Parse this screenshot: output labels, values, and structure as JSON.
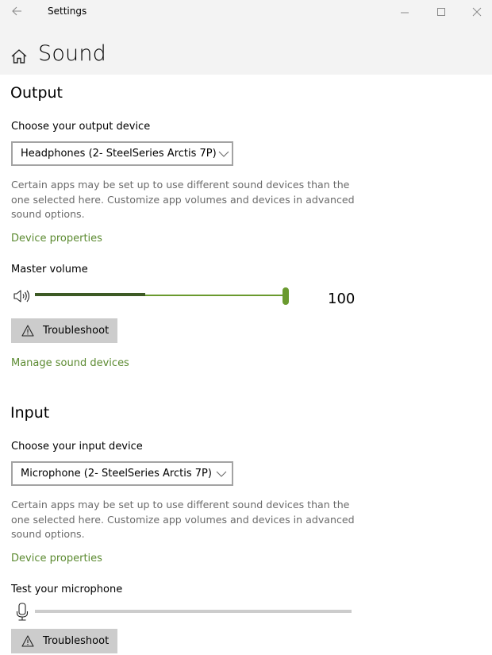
{
  "window": {
    "title": "Settings",
    "back_icon": "back-arrow-icon",
    "controls": [
      "minimize-icon",
      "maximize-icon",
      "close-icon"
    ]
  },
  "header": {
    "icon": "home-icon",
    "title": "Sound"
  },
  "output": {
    "heading": "Output",
    "device_label": "Choose your output device",
    "device_value": "Headphones (2- SteelSeries Arctis 7P)",
    "description": "Certain apps may be set up to use different sound devices than the one selected here. Customize app volumes and devices in advanced sound options.",
    "device_properties_link": "Device properties",
    "master_volume_label": "Master volume",
    "volume_icon": "speaker-icon",
    "volume_value": "100",
    "volume_percent": 100,
    "peak_meter_percent": 44,
    "troubleshoot_label": "Troubleshoot",
    "manage_link": "Manage sound devices"
  },
  "input": {
    "heading": "Input",
    "device_label": "Choose your input device",
    "device_value": "Microphone (2- SteelSeries Arctis 7P)",
    "description": "Certain apps may be set up to use different sound devices than the one selected here. Customize app volumes and devices in advanced sound options.",
    "device_properties_link": "Device properties",
    "test_label": "Test your microphone",
    "mic_icon": "microphone-icon",
    "mic_level_percent": 0,
    "troubleshoot_label": "Troubleshoot"
  },
  "colors": {
    "accent": "#5b8a30",
    "slider_fill": "#6a9a2e",
    "peak_meter": "#3d5a25",
    "header_bg": "#f3f3f3",
    "button_bg": "#cccccc",
    "mic_track": "#cccccc"
  }
}
